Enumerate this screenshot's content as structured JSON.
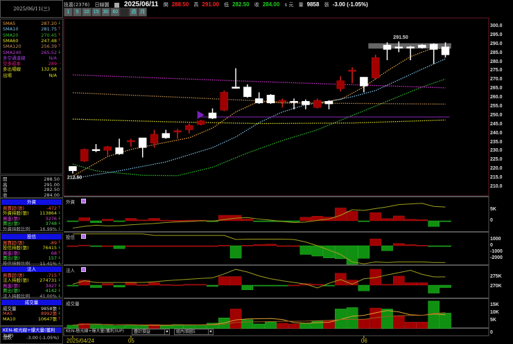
{
  "header": {
    "date_box": "2025/06/11(三)",
    "stock": "技嘉(2376)",
    "chart_type": "日線圖",
    "date": "2025/06/11",
    "open_label": "開",
    "open": "288.50",
    "high_label": "高",
    "high": "291.00",
    "low_label": "低",
    "low": "282.50",
    "close_label": "收",
    "close": "284.00",
    "unit": "s 元",
    "volume_label": "量",
    "volume": "9858",
    "change_label": "張",
    "change": "-3.00 (-1.05%)"
  },
  "toolbar": {
    "buttons": [
      "1",
      "5",
      "10",
      "15",
      "30",
      "60",
      "",
      "週",
      "月"
    ]
  },
  "ma_list": [
    {
      "label": "SMA5",
      "value": "287.20",
      "dir": "down",
      "color": "#e8a040"
    },
    {
      "label": "SMA10",
      "value": "281.75",
      "dir": "up",
      "color": "#7ac0e8"
    },
    {
      "label": "SMA20",
      "value": "270.45",
      "dir": "up",
      "color": "#2ec02e"
    },
    {
      "label": "SMA60",
      "value": "247.48",
      "dir": "up",
      "color": "#e0e020"
    },
    {
      "label": "SMA120",
      "value": "256.39",
      "dir": "up",
      "color": "#c09060"
    },
    {
      "label": "SMA240",
      "value": "265.52",
      "dir": "down",
      "color": "#c040e0"
    },
    {
      "label": "多空通道線",
      "value": "N/A",
      "dir": "",
      "color": "#a040e0"
    },
    {
      "label": "空多成本",
      "value": "289",
      "dir": "flat",
      "color": "#e02080"
    },
    {
      "label": "多出場線",
      "value": "132.98",
      "dir": "flat",
      "color": "#e0e020"
    },
    {
      "label": "出場",
      "value": "N/A",
      "dir": "",
      "color": "#e0e020"
    }
  ],
  "ohlc": [
    {
      "label": "開",
      "value": "288.50"
    },
    {
      "label": "高",
      "value": "291.00"
    },
    {
      "label": "低",
      "value": "282.50"
    },
    {
      "label": "收",
      "value": "284.00"
    }
  ],
  "panels": [
    {
      "title": "外資",
      "rows": [
        {
          "label": "買賣超(張)",
          "value": "-472",
          "dir": "up",
          "color": "#ff6040"
        },
        {
          "label": "外資持股(張)",
          "value": "113864",
          "dir": "down",
          "color": "#e0e020"
        },
        {
          "label": "買進(張)",
          "value": "3276",
          "dir": "down",
          "color": "#e040e0"
        },
        {
          "label": "賣出(張)",
          "value": "3748",
          "dir": "down",
          "color": "#40e040"
        },
        {
          "label": "外資持股比例",
          "value": "16.99%",
          "dir": "down",
          "color": "#aaaaaa"
        }
      ]
    },
    {
      "title": "投信",
      "rows": [
        {
          "label": "買賣超(張)",
          "value": "-89",
          "dir": "up",
          "color": "#ff6040"
        },
        {
          "label": "投信持股(張)",
          "value": "76415",
          "dir": "down",
          "color": "#e0e020"
        },
        {
          "label": "買進(張)",
          "value": "68",
          "dir": "up",
          "color": "#e040e0"
        },
        {
          "label": "賣出(張)",
          "value": "157",
          "dir": "down",
          "color": "#40e040"
        },
        {
          "label": "投信持股比例",
          "value": "11.41%",
          "dir": "down",
          "color": "#aaaaaa"
        }
      ]
    },
    {
      "title": "法人",
      "rows": [
        {
          "label": "買賣超(張)",
          "value": "-715",
          "dir": "up",
          "color": "#ff6040"
        },
        {
          "label": "法人持股(張)",
          "value": "274731",
          "dir": "down",
          "color": "#e0e020"
        },
        {
          "label": "買進(張)",
          "value": "3427",
          "dir": "down",
          "color": "#e040e0"
        },
        {
          "label": "賣出(張)",
          "value": "4142",
          "dir": "down",
          "color": "#40e040"
        },
        {
          "label": "法人持股比例",
          "value": "41.00%",
          "dir": "down",
          "color": "#aaaaaa"
        }
      ]
    },
    {
      "title": "成交量",
      "rows": [
        {
          "label": "成交量",
          "value": "9858張",
          "dir": "down",
          "color": "#dddddd"
        },
        {
          "label": "MA5",
          "value": "8992張",
          "dir": "down",
          "color": "#ff6040"
        },
        {
          "label": "MA10",
          "value": "10647張",
          "dir": "up",
          "color": "#e0e020"
        }
      ]
    }
  ],
  "strategy": {
    "name": "KEN-極光線+爆大量(獲利3UP)",
    "change_label": "漲跌",
    "change": "-3.00 (-1.05%)",
    "overlay": "疊計損益",
    "group": "組內漲圖5"
  },
  "subpanel_titles": [
    "外資",
    "投信",
    "法人",
    "成交量"
  ],
  "chart_data": [
    {
      "type": "candlestick",
      "title": "",
      "ylim": [
        205,
        302
      ],
      "yticks": [
        "300.0",
        "295.0",
        "290.0",
        "285.0",
        "280.0",
        "275.0",
        "270.0",
        "265.0",
        "260.0",
        "255.0",
        "250.0",
        "245.0",
        "240.0",
        "235.0",
        "230.0",
        "225.0",
        "220.0",
        "215.0",
        "210.0"
      ],
      "x_labels": [
        {
          "index": 0,
          "label": "2025/04/24"
        },
        {
          "index": 5,
          "label": "05"
        },
        {
          "index": 25,
          "label": "06"
        }
      ],
      "annotations": [
        {
          "index": 0,
          "text": "212.50"
        },
        {
          "index": 28,
          "text": "291.50"
        }
      ],
      "colors": {
        "up": "#a00000",
        "down": "#ffffff"
      },
      "ohlc": [
        [
          221.5,
          219,
          221.5,
          217.5
        ],
        [
          224.5,
          231,
          231.5,
          224
        ],
        [
          231,
          230.5,
          234,
          229.5
        ],
        [
          230.5,
          232.5,
          233,
          227.5
        ],
        [
          232,
          228.5,
          237,
          228
        ],
        [
          235.5,
          236,
          237,
          232.5
        ],
        [
          237.5,
          232,
          237.5,
          226.5
        ],
        [
          234.5,
          239.5,
          242,
          232
        ],
        [
          240,
          237.5,
          242,
          237
        ],
        [
          241,
          241.5,
          242.5,
          237
        ],
        [
          242,
          244.5,
          245.5,
          240
        ],
        [
          245,
          247,
          247.5,
          244.5
        ],
        [
          251.5,
          248.5,
          254,
          248
        ],
        [
          253,
          263,
          264,
          252.5
        ],
        [
          266,
          265.5,
          276.5,
          265
        ],
        [
          266,
          260.5,
          267.5,
          260
        ],
        [
          259.5,
          257,
          263,
          256.5
        ],
        [
          261.5,
          257,
          262,
          256.5
        ],
        [
          258,
          258.5,
          259.5,
          254.5
        ],
        [
          258,
          257.5,
          259.5,
          253.5
        ],
        [
          258,
          256,
          259,
          253.5
        ],
        [
          254.5,
          258.5,
          259.5,
          254
        ],
        [
          258,
          256.5,
          258.5,
          253.5
        ],
        [
          265,
          269.5,
          272,
          263.5
        ],
        [
          275,
          275.5,
          277,
          268
        ],
        [
          271.5,
          266.5,
          271.5,
          263
        ],
        [
          271,
          282.5,
          284,
          270.5
        ],
        [
          289.5,
          287,
          291,
          281
        ],
        [
          288.5,
          288,
          291.5,
          285.5
        ],
        [
          288.5,
          288,
          289,
          281
        ],
        [
          289.5,
          288,
          290,
          287.5
        ],
        [
          290,
          287,
          290.5,
          279
        ],
        [
          288.5,
          284,
          291,
          282.5
        ]
      ],
      "moving_averages": [
        {
          "name": "SMA5",
          "color": "#e8a040",
          "points": [
            [
              0,
              216
            ],
            [
              3,
              227
            ],
            [
              5,
              231
            ],
            [
              8,
              235
            ],
            [
              10,
              237.5
            ],
            [
              12,
              243
            ],
            [
              14,
              252
            ],
            [
              16,
              258
            ],
            [
              18,
              257
            ],
            [
              21,
              257
            ],
            [
              23,
              259
            ],
            [
              25,
              266
            ],
            [
              27,
              275
            ],
            [
              29,
              283
            ],
            [
              31,
              288
            ],
            [
              32,
              287.2
            ]
          ]
        },
        {
          "name": "SMA10",
          "color": "#7ac0e8",
          "points": [
            [
              0,
              214.7
            ],
            [
              4,
              219
            ],
            [
              8,
              224
            ],
            [
              12,
              232
            ],
            [
              14,
              238
            ],
            [
              16,
              246
            ],
            [
              18,
              252
            ],
            [
              20,
              256
            ],
            [
              22,
              258
            ],
            [
              24,
              260.5
            ],
            [
              26,
              264
            ],
            [
              28,
              270
            ],
            [
              30,
              276
            ],
            [
              32,
              281.75
            ]
          ]
        },
        {
          "name": "SMA20",
          "color": "#2ec02e",
          "points": [
            [
              0,
              222.8
            ],
            [
              2,
              219
            ],
            [
              6,
              216.5
            ],
            [
              9,
              216.3
            ],
            [
              12,
              221
            ],
            [
              15,
              229
            ],
            [
              18,
              236
            ],
            [
              21,
              242
            ],
            [
              24,
              250
            ],
            [
              27,
              258
            ],
            [
              30,
              266
            ],
            [
              32,
              270.45
            ]
          ]
        },
        {
          "name": "SMA60",
          "color": "#e0e020",
          "points": [
            [
              0,
              248
            ],
            [
              8,
              246.5
            ],
            [
              16,
              245.5
            ],
            [
              24,
              245.8
            ],
            [
              32,
              247.48
            ]
          ]
        },
        {
          "name": "SMA120",
          "color": "#c09050",
          "points": [
            [
              0,
              262.8
            ],
            [
              10,
              260
            ],
            [
              20,
              257
            ],
            [
              32,
              256.39
            ]
          ]
        },
        {
          "name": "SMA240",
          "color": "#d030d0",
          "points": [
            [
              0,
              272.8
            ],
            [
              16,
              269
            ],
            [
              32,
              265.52
            ]
          ]
        }
      ],
      "channel_line": {
        "color": "#8a2ac0",
        "start_index": 11,
        "value": 249.2
      },
      "selection_band": {
        "from_index": 26,
        "to_index": 32,
        "ylim": [
          287.5,
          290.5
        ]
      }
    },
    {
      "type": "bar",
      "title": "外資",
      "yticks": [
        {
          "value": 5,
          "label": "5K"
        },
        {
          "value": 0,
          "label": "0"
        }
      ],
      "values": [
        -0.1,
        1.4,
        -0.9,
        0.7,
        -0.1,
        1.1,
        0.4,
        1.1,
        0.3,
        0.2,
        0.3,
        0.3,
        -0.2,
        2.5,
        2.5,
        0.8,
        -0.1,
        -0.2,
        -0.2,
        -0.1,
        1.6,
        2.1,
        1.7,
        5.8,
        4.3,
        -0.1,
        3.7,
        1.0,
        2.2,
        0.7,
        0.5,
        -2.6,
        -0.2
      ],
      "line": [
        -3.3,
        -2.5,
        -2.0,
        -2.3,
        -2.2,
        -1.8,
        -1.5,
        -1.2,
        -0.8,
        -0.5,
        -0.3,
        0,
        -0.1,
        0.5,
        1.2,
        1.5,
        0.8,
        0.3,
        -0.3,
        -0.8,
        -0.6,
        0.2,
        0.8,
        2.5,
        5.0,
        4.7,
        5.5,
        6.3,
        7.3,
        7.6,
        7.9,
        6.5,
        6.2
      ]
    },
    {
      "type": "bar",
      "title": "投信",
      "yticks": [
        {
          "value": 1000,
          "label": "1000"
        },
        {
          "value": 0,
          "label": "0"
        },
        {
          "value": -1000,
          "label": "-1000"
        },
        {
          "value": -2000,
          "label": "-2000"
        }
      ],
      "values": [
        0,
        100,
        -100,
        0,
        -480,
        0,
        0,
        0,
        0,
        0,
        0,
        0,
        0,
        80,
        -2000,
        80,
        180,
        250,
        10,
        10,
        -1400,
        -1670,
        -1960,
        -2100,
        -3000,
        -2030,
        1100,
        -810,
        370,
        180,
        80,
        -80,
        -80
      ],
      "line": [
        1900,
        1900,
        1900,
        1900,
        1900,
        1900,
        1900,
        1650,
        1650,
        1650,
        1650,
        1650,
        1650,
        1650,
        1000,
        1050,
        1050,
        1050,
        1050,
        1000,
        600,
        0,
        -700,
        -1400,
        -2600,
        -2900,
        -2600,
        -2700,
        -2600,
        -2600,
        -2600,
        -2700,
        -2700
      ]
    },
    {
      "type": "bar",
      "title": "法人",
      "yticks": [
        {
          "value": 275,
          "label": "275K"
        },
        {
          "value": 270,
          "label": "270K"
        }
      ],
      "values": [
        -0.1,
        2.3,
        -1.1,
        0.7,
        -0.9,
        1.4,
        0.2,
        1.2,
        0.3,
        0.1,
        0.4,
        0.4,
        -0.6,
        3.9,
        3.9,
        -2.1,
        -0.2,
        -0.1,
        -0.2,
        0.05,
        0.7,
        0.4,
        -0.2,
        5.4,
        2.3,
        -2.6,
        7.2,
        0.4,
        4.1,
        1.1,
        1.1,
        -3.6,
        -1.1
      ],
      "line": [
        271.2,
        273,
        272.1,
        272.1,
        272.1,
        272.1,
        272.1,
        272.5,
        273,
        273.4,
        273.8,
        274.2,
        274.5,
        276.5,
        278.9,
        277.5,
        275.5,
        274,
        273,
        272.1,
        271.3,
        269.3,
        271.7,
        273.6,
        271.2,
        274,
        274.6,
        276,
        277.2,
        278.4,
        276.3,
        275,
        275
      ]
    },
    {
      "type": "bar",
      "title": "成交量",
      "yticks": [
        {
          "value": 15,
          "label": "15K"
        },
        {
          "value": 10,
          "label": "10K"
        },
        {
          "value": 5,
          "label": "5K"
        },
        {
          "value": 0,
          "label": "0"
        }
      ],
      "values": [
        2.1,
        3.2,
        2.9,
        2.0,
        1.8,
        2.0,
        1.8,
        2.5,
        1.9,
        2.6,
        2.4,
        2.2,
        3.4,
        6.8,
        12.5,
        5.6,
        2.9,
        4.1,
        3.4,
        2.9,
        3.4,
        4.9,
        5.1,
        12.5,
        13.4,
        6.0,
        13.1,
        12.5,
        8.1,
        4.1,
        4.1,
        17.6,
        9.858
      ],
      "directions": "dudddddudddddduddduuddudduuduuudd"
    }
  ]
}
